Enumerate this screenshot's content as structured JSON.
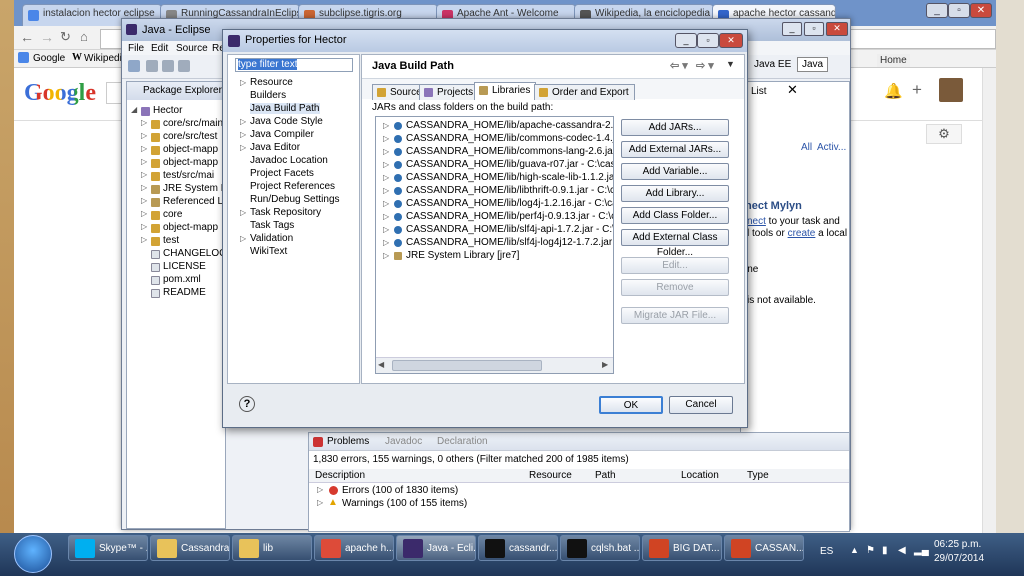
{
  "browser": {
    "tabs": [
      {
        "label": "instalacion hector eclipse",
        "color": "#4a86e8"
      },
      {
        "label": "RunningCassandraInEclipse",
        "color": "#888888"
      },
      {
        "label": "subclipse.tigris.org",
        "color": "#cc6633"
      },
      {
        "label": "Apache Ant - Welcome",
        "color": "#cc3366"
      },
      {
        "label": "Wikipedia, la enciclopedia",
        "color": "#555555"
      },
      {
        "label": "apache hector cassandra",
        "color": "#3366cc"
      }
    ],
    "omnibox": "",
    "bookmarks": [
      "Google",
      "Wikipedi"
    ],
    "google_logo": "Google",
    "home_link": "Home"
  },
  "eclipse": {
    "title": "Java - Eclipse",
    "menu": [
      "File",
      "Edit",
      "Source",
      "Re"
    ],
    "perspectives": [
      "Java EE",
      "Java"
    ],
    "package_explorer": {
      "title": "Package Explorer",
      "items": [
        {
          "label": "Hector",
          "level": 0,
          "icon": "project-icon"
        },
        {
          "label": "core/src/main",
          "level": 1,
          "icon": "source-folder-icon"
        },
        {
          "label": "core/src/test",
          "level": 1,
          "icon": "source-folder-icon"
        },
        {
          "label": "object-mapp",
          "level": 1,
          "icon": "source-folder-icon"
        },
        {
          "label": "object-mapp",
          "level": 1,
          "icon": "source-folder-icon"
        },
        {
          "label": "test/src/mai",
          "level": 1,
          "icon": "source-folder-icon"
        },
        {
          "label": "JRE System Li",
          "level": 1,
          "icon": "library-icon"
        },
        {
          "label": "Referenced Li",
          "level": 1,
          "icon": "library-icon"
        },
        {
          "label": "core",
          "level": 1,
          "icon": "folder-icon"
        },
        {
          "label": "object-mapp",
          "level": 1,
          "icon": "folder-icon"
        },
        {
          "label": "test",
          "level": 1,
          "icon": "folder-icon"
        },
        {
          "label": "CHANGELOG",
          "level": 1,
          "icon": "file-icon"
        },
        {
          "label": "LICENSE",
          "level": 1,
          "icon": "file-icon"
        },
        {
          "label": "pom.xml",
          "level": 1,
          "icon": "file-icon"
        },
        {
          "label": "README",
          "level": 1,
          "icon": "file-icon"
        }
      ]
    },
    "right_panel": {
      "list_tab": "List",
      "all_link": "All",
      "activate_link": "Activ...",
      "mylyn_title": "nect Mylyn",
      "mylyn_text1": "nect",
      "mylyn_text1b": " to your task and",
      "mylyn_text2": "l tools or ",
      "mylyn_create": "create",
      "mylyn_text2b": " a local",
      "outline_title": "ine",
      "outline_text": "is not available."
    },
    "problems": {
      "tabs": [
        "Problems",
        "Javadoc",
        "Declaration"
      ],
      "summary": "1,830 errors, 155 warnings, 0 others (Filter matched 200 of 1985 items)",
      "columns": [
        "Description",
        "Resource",
        "Path",
        "Location",
        "Type"
      ],
      "rows": [
        {
          "label": "Errors (100 of 1830 items)",
          "icon": "error-icon"
        },
        {
          "label": "Warnings (100 of 155 items)",
          "icon": "warning-icon"
        }
      ]
    }
  },
  "dialog": {
    "title": "Properties for Hector",
    "filter_placeholder": "type filter text",
    "nav": [
      {
        "label": "Resource",
        "expandable": true
      },
      {
        "label": "Builders",
        "expandable": false
      },
      {
        "label": "Java Build Path",
        "expandable": false,
        "selected": true
      },
      {
        "label": "Java Code Style",
        "expandable": true
      },
      {
        "label": "Java Compiler",
        "expandable": true
      },
      {
        "label": "Java Editor",
        "expandable": true
      },
      {
        "label": "Javadoc Location",
        "expandable": false
      },
      {
        "label": "Project Facets",
        "expandable": false
      },
      {
        "label": "Project References",
        "expandable": false
      },
      {
        "label": "Run/Debug Settings",
        "expandable": false
      },
      {
        "label": "Task Repository",
        "expandable": true
      },
      {
        "label": "Task Tags",
        "expandable": false
      },
      {
        "label": "Validation",
        "expandable": true
      },
      {
        "label": "WikiText",
        "expandable": false
      }
    ],
    "section_title": "Java Build Path",
    "tabs": [
      "Source",
      "Projects",
      "Libraries",
      "Order and Export"
    ],
    "active_tab": "Libraries",
    "list_description": "JARs and class folders on the build path:",
    "libraries": [
      "CASSANDRA_HOME/lib/apache-cassandra-2.0.7.jar - C:",
      "CASSANDRA_HOME/lib/commons-codec-1.4.jar - C:\\ca",
      "CASSANDRA_HOME/lib/commons-lang-2.6.jar - C:\\ca",
      "CASSANDRA_HOME/lib/guava-r07.jar - C:\\cassandra\\li",
      "CASSANDRA_HOME/lib/high-scale-lib-1.1.2.jar - C:\\ca",
      "CASSANDRA_HOME/lib/libthrift-0.9.1.jar - C:\\cassandra",
      "CASSANDRA_HOME/lib/log4j-1.2.16.jar - C:\\cassandra\\",
      "CASSANDRA_HOME/lib/perf4j-0.9.13.jar - C:\\cassandra",
      "CASSANDRA_HOME/lib/slf4j-api-1.7.2.jar - C:\\cassand",
      "CASSANDRA_HOME/lib/slf4j-log4j12-1.7.2.jar - C:\\cas",
      "JRE System Library [jre7]"
    ],
    "side_buttons": [
      {
        "label": "Add JARs...",
        "enabled": true
      },
      {
        "label": "Add External JARs...",
        "enabled": true
      },
      {
        "label": "Add Variable...",
        "enabled": true
      },
      {
        "label": "Add Library...",
        "enabled": true
      },
      {
        "label": "Add Class Folder...",
        "enabled": true
      },
      {
        "label": "Add External Class Folder...",
        "enabled": true
      },
      {
        "label": "Edit...",
        "enabled": false
      },
      {
        "label": "Remove",
        "enabled": false
      },
      {
        "label": "Migrate JAR File...",
        "enabled": false
      }
    ],
    "ok_label": "OK",
    "cancel_label": "Cancel",
    "help_label": "?"
  },
  "taskbar": {
    "items": [
      {
        "label": "Skype™ - ...",
        "color": "#00aff0"
      },
      {
        "label": "Cassandra",
        "color": "#e8c25a"
      },
      {
        "label": "lib",
        "color": "#e8c25a"
      },
      {
        "label": "apache h...",
        "color": "#dd4b39"
      },
      {
        "label": "Java - Ecli...",
        "color": "#3b2a6b"
      },
      {
        "label": "cassandr...",
        "color": "#111111"
      },
      {
        "label": "cqlsh.bat ...",
        "color": "#111111"
      },
      {
        "label": "BIG DAT...",
        "color": "#d04423"
      },
      {
        "label": "CASSAN...",
        "color": "#d04423"
      }
    ],
    "language": "ES",
    "time": "06:25 p.m.",
    "date": "29/07/2014"
  }
}
